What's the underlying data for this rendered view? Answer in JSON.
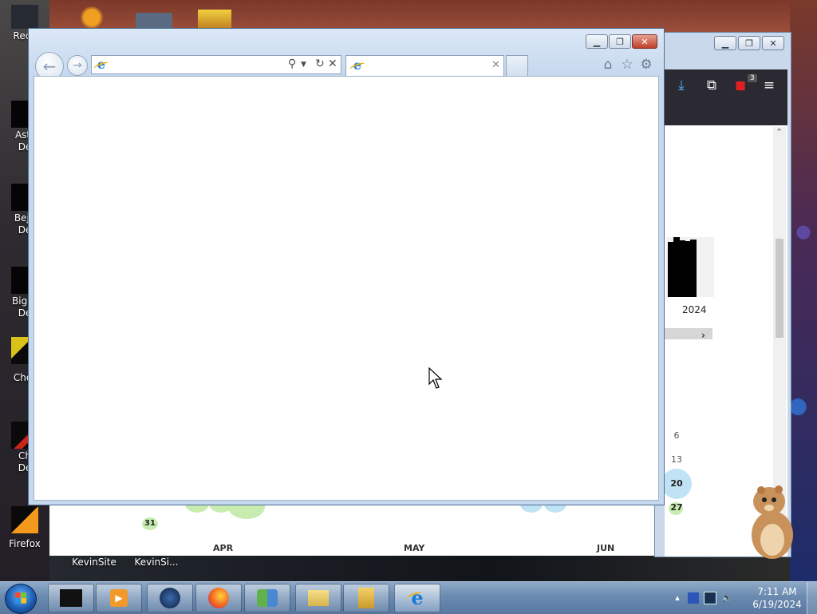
{
  "desktop": {
    "icons": [
      {
        "label_line1": "Recy",
        "label_line2": ""
      },
      {
        "label_line1": "Astr",
        "label_line2": "De"
      },
      {
        "label_line1": "Beje",
        "label_line2": "De"
      },
      {
        "label_line1": "Big N",
        "label_line2": "De"
      },
      {
        "label_line1": "Chor",
        "label_line2": ""
      },
      {
        "label_line1": "Ch",
        "label_line2": "De"
      },
      {
        "label_line1": "Firefox",
        "label_line2": ""
      }
    ],
    "bottom_icon_labels": [
      "KevinSite",
      "KevinSi..."
    ]
  },
  "firefox_window": {
    "extension_badge": "3",
    "year_label": "2024",
    "calendar_numbers": [
      "6",
      "13",
      "20",
      "27"
    ],
    "chart_bar_heights": [
      0.92,
      1.0,
      0.95,
      0.93,
      0.96
    ]
  },
  "calendar_strip": {
    "highlighted_day": "31",
    "months": [
      "APR",
      "MAY",
      "JUN"
    ]
  },
  "ie_window": {
    "address_value": "",
    "tab_title": "",
    "icons": [
      "back-icon",
      "forward-icon",
      "search-icon",
      "refresh-icon",
      "stop-icon",
      "home-icon",
      "favorites-icon",
      "tools-gear-icon"
    ]
  },
  "taskbar": {
    "clock_time": "7:11 AM",
    "clock_date": "6/19/2024",
    "pinned": [
      "file-explorer-black",
      "media-player",
      "circle-app",
      "firefox",
      "people-app",
      "picture-folder",
      "folder",
      "internet-explorer"
    ]
  },
  "colors": {
    "ie_frame": "#c6d8ee",
    "ff_toolbar": "#2b2a33",
    "taskbar": "#6a8ab0",
    "bubble_blue": "#bfe3f5",
    "bubble_green": "#c8ecb0"
  }
}
